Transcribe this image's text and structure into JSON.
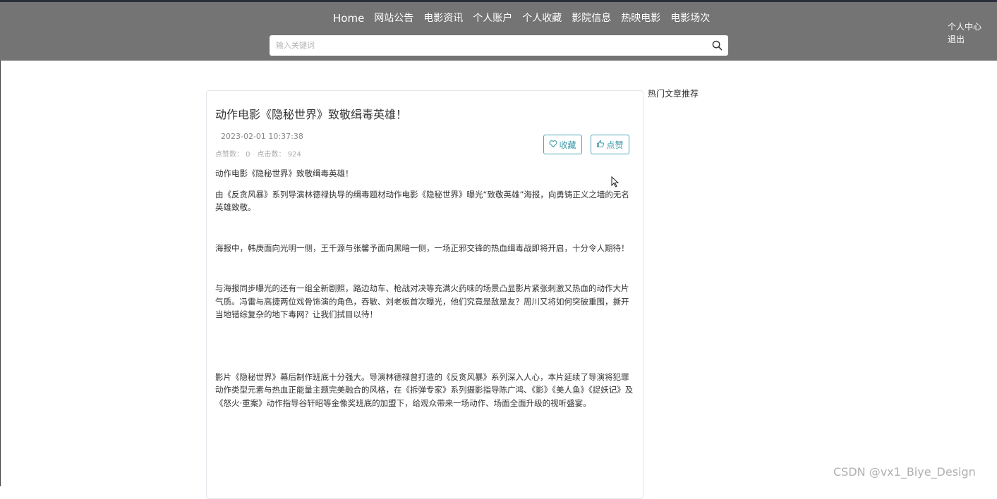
{
  "nav": {
    "items": [
      "Home",
      "网站公告",
      "电影资讯",
      "个人账户",
      "个人收藏",
      "影院信息",
      "热映电影",
      "电影场次"
    ]
  },
  "search": {
    "placeholder": "输入关键词"
  },
  "user_menu": {
    "center": "个人中心",
    "logout": "退出"
  },
  "article": {
    "title": "动作电影《隐秘世界》致敬缉毒英雄！",
    "date": "2023-02-01 10:37:38",
    "likes": "点赞数： 0",
    "clicks": "点击数： 924",
    "fav_label": "收藏",
    "like_label": "点赞",
    "paragraphs": [
      "动作电影《隐秘世界》致敬缉毒英雄！",
      "由《反贪风暴》系列导演林德禄执导的缉毒题材动作电影《隐秘世界》曝光“致敬英雄”海报，向勇铸正义之墙的无名英雄致敬。",
      "海报中，韩庚面向光明一侧，王千源与张馨予面向黑暗一侧，一场正邪交锋的热血缉毒战即将开启，十分令人期待！",
      "与海报同步曝光的还有一组全新剧照，路边劫车、枪战对决等充满火药味的场景凸显影片紧张刺激又热血的动作大片气质。冯雷与高捷两位戏骨饰演的角色，吞敏、刘老板首次曝光，他们究竟是敌是友？周川又将如何突破重围，撕开当地错综复杂的地下毒网？让我们拭目以待！",
      "影片《隐秘世界》幕后制作班底十分强大。导演林德禄曾打造的《反贪风暴》系列深入人心，本片延续了导演将犯罪动作类型元素与热血正能量主题完美融合的风格，在《拆弹专家》系列摄影指导陈广鸿、《影》《美人鱼》《捉妖记》及《怒火·重案》动作指导谷轩昭等金像奖班底的加盟下，给观众带来一场动作、场面全面升级的视听盛宴。"
    ]
  },
  "sidebar": {
    "title": "热门文章推荐"
  },
  "watermark": "CSDN @vx1_Biye_Design",
  "colors": {
    "header_bg": "#747474",
    "accent": "#3b97a8"
  }
}
